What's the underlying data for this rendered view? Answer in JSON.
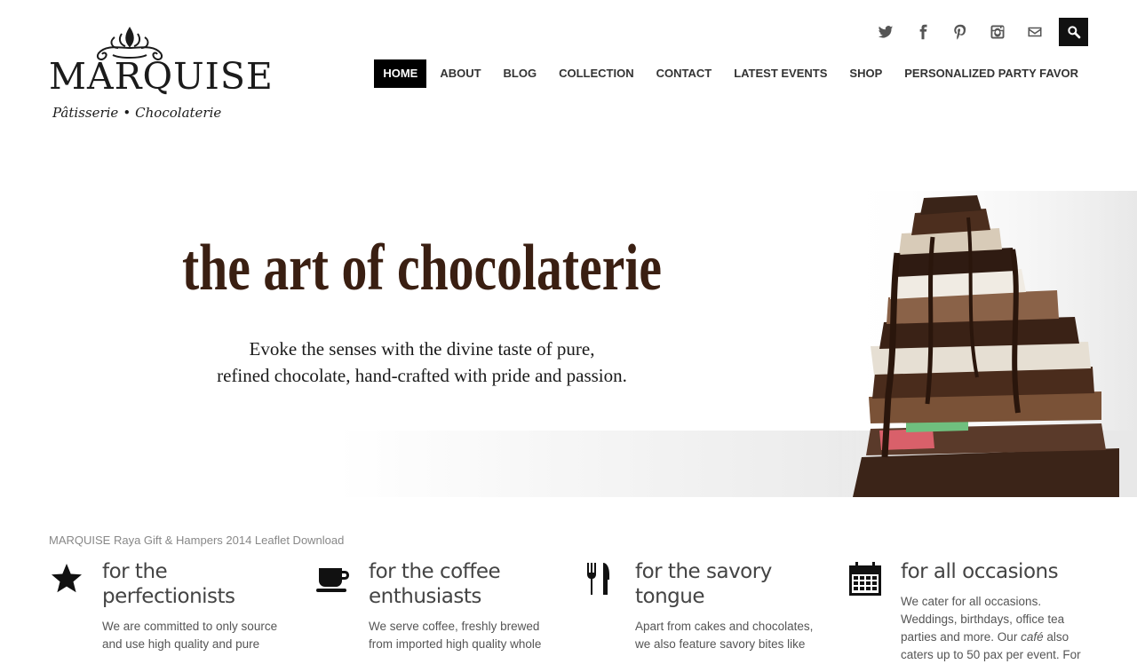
{
  "brand": {
    "name": "MARQUISE",
    "tagline_left": "Pâtisserie",
    "tagline_right": "Chocolaterie"
  },
  "social": [
    {
      "name": "twitter-icon"
    },
    {
      "name": "facebook-icon"
    },
    {
      "name": "pinterest-icon"
    },
    {
      "name": "instagram-icon"
    },
    {
      "name": "email-icon"
    }
  ],
  "nav": {
    "items": [
      {
        "label": "HOME",
        "active": true
      },
      {
        "label": "ABOUT"
      },
      {
        "label": "BLOG"
      },
      {
        "label": "COLLECTION"
      },
      {
        "label": "CONTACT"
      },
      {
        "label": "LATEST EVENTS"
      },
      {
        "label": "SHOP"
      },
      {
        "label": "PERSONALIZED PARTY FAVOR"
      }
    ]
  },
  "hero": {
    "title": "the art of chocolaterie",
    "subtitle_line1": "Evoke the senses with the divine taste of pure,",
    "subtitle_line2": "refined chocolate, hand-crafted with pride and passion."
  },
  "leaflet_link": "MARQUISE Raya Gift & Hampers 2014 Leaflet Download",
  "features": [
    {
      "icon": "star-icon",
      "title": "for the perfectionists",
      "text": "We are committed to only source and use high quality and pure"
    },
    {
      "icon": "coffee-cup-icon",
      "title": "for the coffee enthusiasts",
      "text": "We serve coffee, freshly brewed from imported high quality whole"
    },
    {
      "icon": "fork-knife-icon",
      "title": "for the savory tongue",
      "text": "Apart from cakes and chocolates, we also feature savory bites like"
    },
    {
      "icon": "calendar-icon",
      "title": "for all occasions",
      "text_before": "We cater for all occasions. Weddings, birthdays, office tea parties and more. Our ",
      "text_em": "café",
      "text_after": " also caters up to 50 pax per event. For"
    }
  ],
  "colors": {
    "title_brown": "#3a1f12",
    "nav_active_bg": "#000000"
  }
}
